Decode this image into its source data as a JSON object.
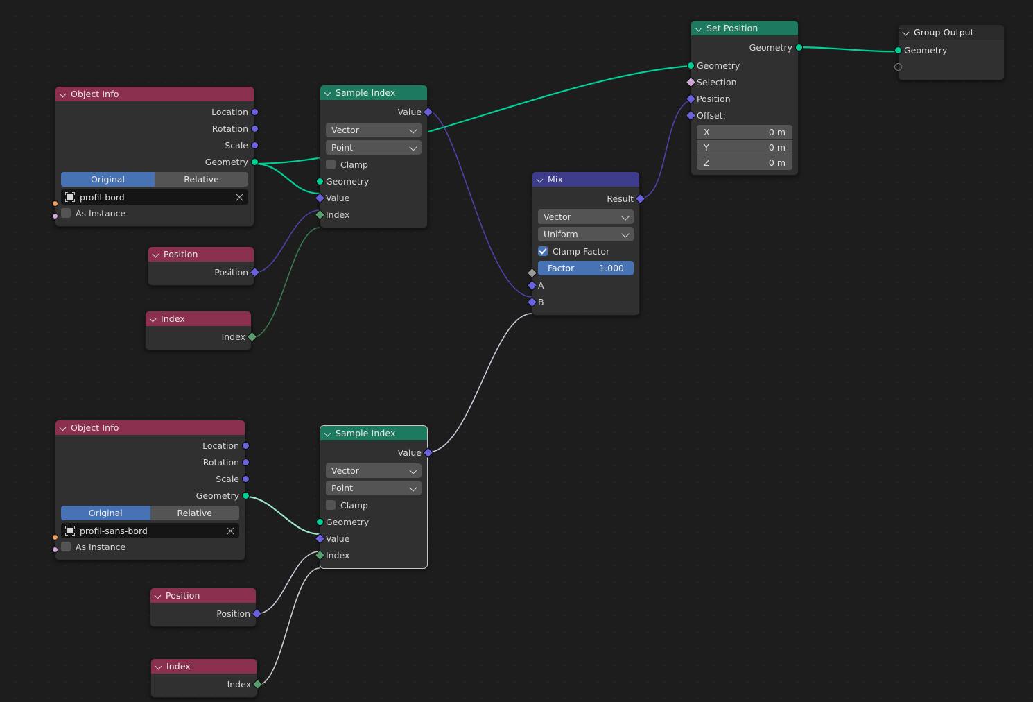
{
  "editor": {
    "name": "Geometry Node Editor",
    "background_color": "#1d1d1d"
  },
  "colors": {
    "header_red": "#8a2f4d",
    "header_green": "#1d7a5f",
    "header_blue": "#3c3c8a",
    "header_dark": "#2b2b2b",
    "socket_geometry": "#00cf96",
    "socket_vector": "#6a62dc",
    "socket_integer": "#5a9e6f",
    "socket_boolean": "#cca6d6",
    "socket_object": "#ed9e5c",
    "accent_blue": "#4772b3",
    "wire_geometry": "#00cf96",
    "wire_vector": "#5a52b8",
    "wire_integer": "#3f7a52",
    "wire_selected": "#d8d8e8"
  },
  "nodes": {
    "object_info_top": {
      "title": "Object Info",
      "outputs": [
        "Location",
        "Rotation",
        "Scale",
        "Geometry"
      ],
      "transform_space": {
        "options": [
          "Original",
          "Relative"
        ],
        "selected": "Original"
      },
      "object_field": {
        "value": "profil-bord",
        "icon": "object-icon",
        "clear_icon": "close-icon"
      },
      "as_instance": {
        "label": "As Instance",
        "checked": false
      }
    },
    "object_info_bottom": {
      "title": "Object Info",
      "outputs": [
        "Location",
        "Rotation",
        "Scale",
        "Geometry"
      ],
      "transform_space": {
        "options": [
          "Original",
          "Relative"
        ],
        "selected": "Original"
      },
      "object_field": {
        "value": "profil-sans-bord",
        "icon": "object-icon",
        "clear_icon": "close-icon"
      },
      "as_instance": {
        "label": "As Instance",
        "checked": false
      }
    },
    "position_top": {
      "title": "Position",
      "output": "Position"
    },
    "index_top": {
      "title": "Index",
      "output": "Index"
    },
    "position_bottom": {
      "title": "Position",
      "output": "Position"
    },
    "index_bottom": {
      "title": "Index",
      "output": "Index"
    },
    "sample_index_top": {
      "title": "Sample Index",
      "output": "Value",
      "data_type": {
        "selected": "Vector"
      },
      "domain": {
        "selected": "Point"
      },
      "clamp": {
        "label": "Clamp",
        "checked": false
      },
      "inputs": [
        "Geometry",
        "Value",
        "Index"
      ]
    },
    "sample_index_bottom": {
      "title": "Sample Index",
      "output": "Value",
      "data_type": {
        "selected": "Vector"
      },
      "domain": {
        "selected": "Point"
      },
      "clamp": {
        "label": "Clamp",
        "checked": false
      },
      "inputs": [
        "Geometry",
        "Value",
        "Index"
      ],
      "selected": true
    },
    "mix": {
      "title": "Mix",
      "output": "Result",
      "data_type": {
        "selected": "Vector"
      },
      "factor_mode": {
        "selected": "Uniform"
      },
      "clamp_factor": {
        "label": "Clamp Factor",
        "checked": true
      },
      "factor": {
        "label": "Factor",
        "value": "1.000"
      },
      "inputs": [
        "A",
        "B"
      ]
    },
    "set_position": {
      "title": "Set Position",
      "output": "Geometry",
      "inputs": [
        "Geometry",
        "Selection",
        "Position",
        "Offset:"
      ],
      "offset": [
        {
          "axis": "X",
          "value": "0 m"
        },
        {
          "axis": "Y",
          "value": "0 m"
        },
        {
          "axis": "Z",
          "value": "0 m"
        }
      ]
    },
    "group_output": {
      "title": "Group Output",
      "inputs": [
        "Geometry"
      ],
      "has_empty_socket": true
    }
  }
}
